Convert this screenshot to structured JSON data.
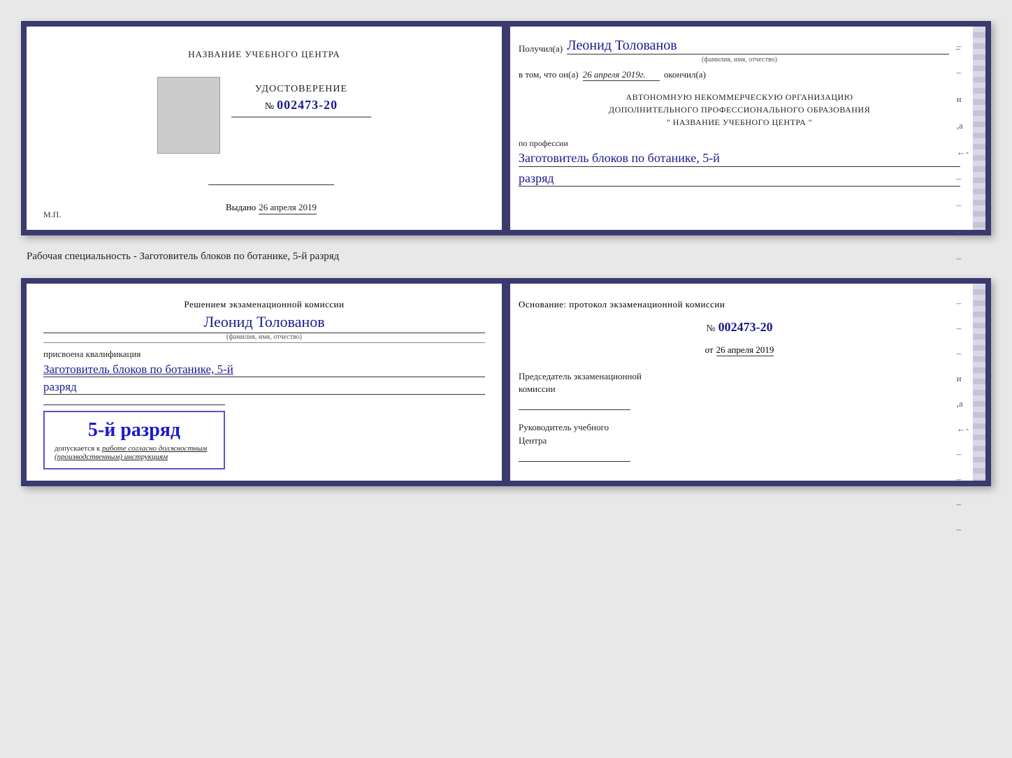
{
  "doc1": {
    "left": {
      "center_title": "НАЗВАНИЕ УЧЕБНОГО ЦЕНТРА",
      "udostoverenie_title": "УДОСТОВЕРЕНИЕ",
      "number_prefix": "№",
      "number": "002473-20",
      "vydano_label": "Выдано",
      "vydano_date": "26 апреля 2019",
      "mp_label": "М.П."
    },
    "right": {
      "recipient_label": "Получил(а)",
      "recipient_name": "Леонид Толованов",
      "recipient_dash": "–",
      "fio_sub": "(фамилия, имя, отчество)",
      "vtom_prefix": "в том, что он(а)",
      "vtom_date": "26 апреля 2019г.",
      "vtom_suffix": "окончил(а)",
      "org_line1": "АВТОНОМНУЮ НЕКОММЕРЧЕСКУЮ ОРГАНИЗАЦИЮ",
      "org_line2": "ДОПОЛНИТЕЛЬНОГО ПРОФЕССИОНАЛЬНОГО ОБРАЗОВАНИЯ",
      "org_line3": "\"   НАЗВАНИЕ УЧЕБНОГО ЦЕНТРА   \"",
      "po_professii": "по профессии",
      "profession": "Заготовитель блоков по ботанике, 5-й",
      "razryad": "разряд"
    }
  },
  "specialty_label": "Рабочая специальность - Заготовитель блоков по ботанике, 5-й разряд",
  "doc2": {
    "left": {
      "resheniyem": "Решением экзаменационной комиссии",
      "person_name": "Леонид Толованов",
      "fio_sub": "(фамилия, имя, отчество)",
      "prisvoena": "присвоена квалификация",
      "qualification": "Заготовитель блоков по ботанике, 5-й",
      "razryad": "разряд",
      "stamp_razryad": "5-й разряд",
      "dopuskaetsya": "допускается к",
      "rabote": "работе согласно должностным",
      "instruktsiyam": "(производственным) инструкциям"
    },
    "right": {
      "osnovanie": "Основание: протокол экзаменационной комиссии",
      "number_prefix": "№",
      "number": "002473-20",
      "ot_prefix": "от",
      "ot_date": "26 апреля 2019",
      "chairman_line1": "Председатель экзаменационной",
      "chairman_line2": "комиссии",
      "rukovoditel_line1": "Руководитель учебного",
      "rukovoditel_line2": "Центра"
    }
  }
}
